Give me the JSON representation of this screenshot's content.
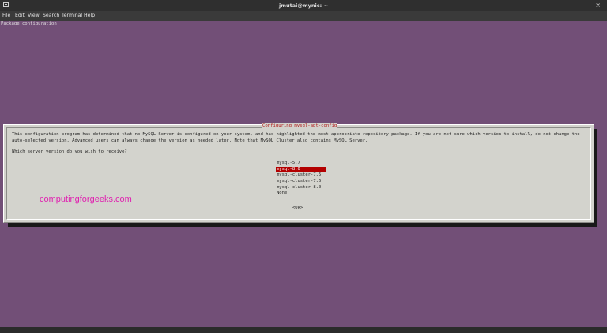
{
  "window": {
    "title": "jmutai@mynic: ~",
    "close_icon": "×"
  },
  "menubar": {
    "items": [
      "File",
      "Edit",
      "View",
      "Search",
      "Terminal",
      "Help"
    ]
  },
  "terminal": {
    "header_text": "Package configuration",
    "background_color": "#724f77"
  },
  "dialog": {
    "title": "Configuring mysql-apt-config",
    "body": "This configuration program has determined that no MySQL Server is configured on your system, and has highlighted the most appropriate repository package. If you are not sure which version to install, do not change the auto-selected version. Advanced users can always change the version as needed later. Note that MySQL Cluster also contains MySQL Server.",
    "question": "Which server version do you wish to receive?",
    "options": [
      "mysql-5.7",
      "mysql-8.0",
      "mysql-cluster-7.5",
      "mysql-cluster-7.6",
      "mysql-cluster-8.0",
      "None"
    ],
    "selected_option": "mysql-8.0",
    "ok_label": "<Ok>",
    "highlight_color": "#b30000"
  },
  "watermark": {
    "text": "computingforgeeks.com",
    "color": "#e020b0"
  }
}
